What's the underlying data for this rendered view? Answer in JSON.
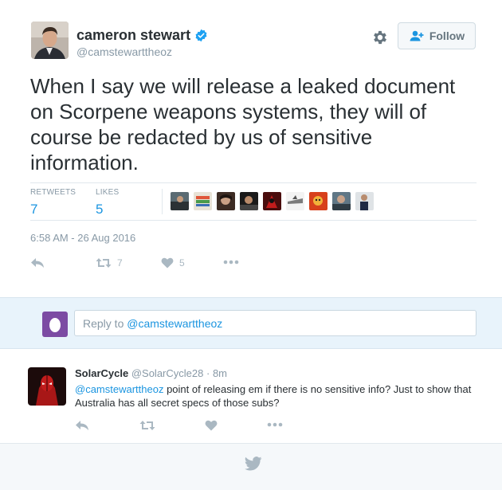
{
  "tweet": {
    "author_name": "cameron stewart",
    "author_handle": "@camstewarttheoz",
    "follow_label": "Follow",
    "text": "When I say we will release a leaked document on Scorpene weapons systems, they will of course be redacted by us of sensitive information.",
    "stats": {
      "retweets_label": "RETWEETS",
      "retweets_value": "7",
      "likes_label": "LIKES",
      "likes_value": "5"
    },
    "timestamp": "6:58 AM - 26 Aug 2016",
    "actions": {
      "retweet_count": "7",
      "like_count": "5"
    }
  },
  "reply_box": {
    "prefix": "Reply to ",
    "mention": "@camstewarttheoz"
  },
  "reply": {
    "name": "SolarCycle",
    "handle": "@SolarCycle28",
    "separator": "·",
    "time": "8m",
    "mention": "@camstewarttheoz",
    "text": " point of releasing em if there is no sensitive info? Just to show that Australia has all secret specs of those subs?"
  },
  "colors": {
    "accent": "#1b95e0",
    "verified": "#1da1f2",
    "muted": "#8899a6",
    "reply_band": "#e8f3fb",
    "reply_avatar": "#7c4ba3"
  },
  "icons": {
    "verified": "verified-badge-icon",
    "gear": "gear-icon",
    "follow": "add-user-icon",
    "reply": "reply-arrow-icon",
    "retweet": "retweet-icon",
    "like": "heart-icon",
    "more": "more-dots-icon",
    "footer": "twitter-bird-icon"
  }
}
